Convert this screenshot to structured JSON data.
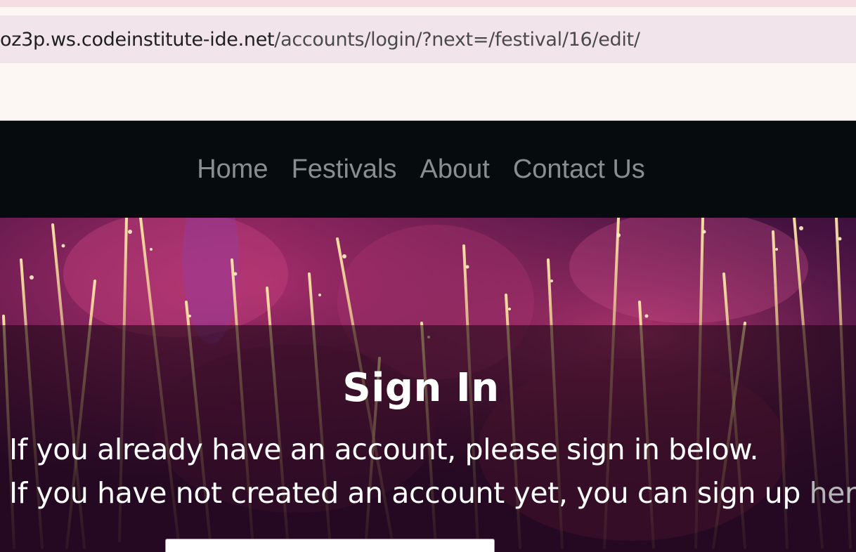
{
  "browser": {
    "url_host": "oz3p.ws.codeinstitute-ide.net",
    "url_path": "/accounts/login/?next=/festival/16/edit/"
  },
  "nav": {
    "items": [
      {
        "label": "Home"
      },
      {
        "label": "Festivals"
      },
      {
        "label": "About"
      },
      {
        "label": "Contact Us"
      }
    ]
  },
  "signin": {
    "title": "Sign In",
    "line1": "If you already have an account, please sign in below.",
    "line2_prefix": "If you have not created an account yet, you can sign up ",
    "line2_link": "here",
    "line2_suffix": "."
  },
  "colors": {
    "nav_bg": "#060c0e",
    "nav_link": "#8b8e8f",
    "link_here": "#b4b6b8",
    "hero_base": "#3a0f3c"
  }
}
